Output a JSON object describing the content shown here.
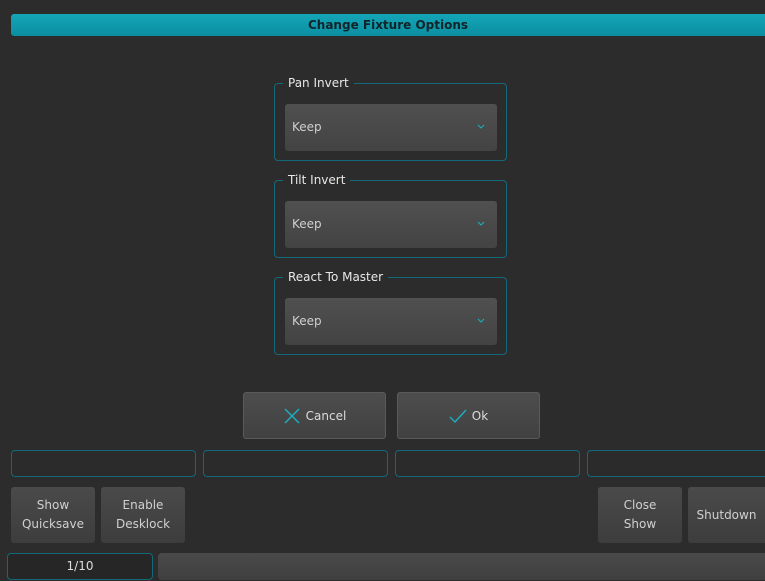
{
  "dialog": {
    "title": "Change Fixture Options"
  },
  "options": [
    {
      "label": "Pan Invert",
      "value": "Keep"
    },
    {
      "label": "Tilt Invert",
      "value": "Keep"
    },
    {
      "label": "React To Master",
      "value": "Keep"
    }
  ],
  "buttons": {
    "cancel": "Cancel",
    "ok": "Ok"
  },
  "softkeys": {
    "show_quicksave_line1": "Show",
    "show_quicksave_line2": "Quicksave",
    "enable_desklock_line1": "Enable",
    "enable_desklock_line2": "Desklock",
    "close_show_line1": "Close",
    "close_show_line2": "Show",
    "shutdown": "Shutdown"
  },
  "footer": {
    "page": "1/10"
  },
  "colors": {
    "accent": "#0b9bb0",
    "background": "#2c2c2c",
    "border": "#13697a"
  }
}
